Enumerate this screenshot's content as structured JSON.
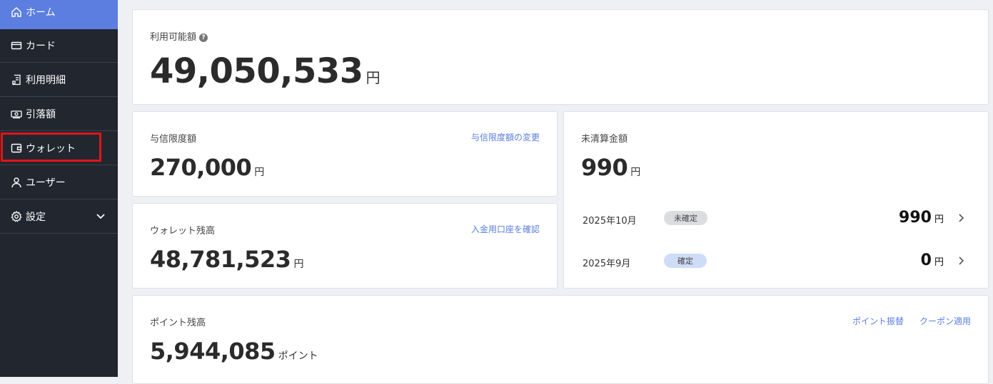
{
  "sidebar": {
    "items": [
      {
        "label": "ホーム",
        "icon": "home-icon"
      },
      {
        "label": "カード",
        "icon": "card-icon"
      },
      {
        "label": "利用明細",
        "icon": "statement-icon"
      },
      {
        "label": "引落額",
        "icon": "cash-icon"
      },
      {
        "label": "ウォレット",
        "icon": "wallet-icon"
      },
      {
        "label": "ユーザー",
        "icon": "user-icon"
      },
      {
        "label": "設定",
        "icon": "gear-icon"
      }
    ],
    "active_color": "#5b7ee0",
    "highlight_color": "#e01616"
  },
  "available": {
    "label": "利用可能額",
    "help": "?",
    "amount": "49,050,533",
    "unit": "円"
  },
  "credit_limit": {
    "label": "与信限度額",
    "link": "与信限度額の変更",
    "amount": "270,000",
    "unit": "円"
  },
  "wallet_balance": {
    "label": "ウォレット残高",
    "link": "入金用口座を確認",
    "amount": "48,781,523",
    "unit": "円"
  },
  "unsettled": {
    "label": "未清算金額",
    "amount": "990",
    "unit": "円",
    "rows": [
      {
        "month": "2025年10月",
        "status": "未確定",
        "amount": "990",
        "unit": "円"
      },
      {
        "month": "2025年9月",
        "status": "確定",
        "amount": "0",
        "unit": "円"
      }
    ]
  },
  "points": {
    "label": "ポイント残高",
    "link_transfer": "ポイント振替",
    "link_coupon": "クーポン適用",
    "amount": "5,944,085",
    "unit": "ポイント"
  }
}
